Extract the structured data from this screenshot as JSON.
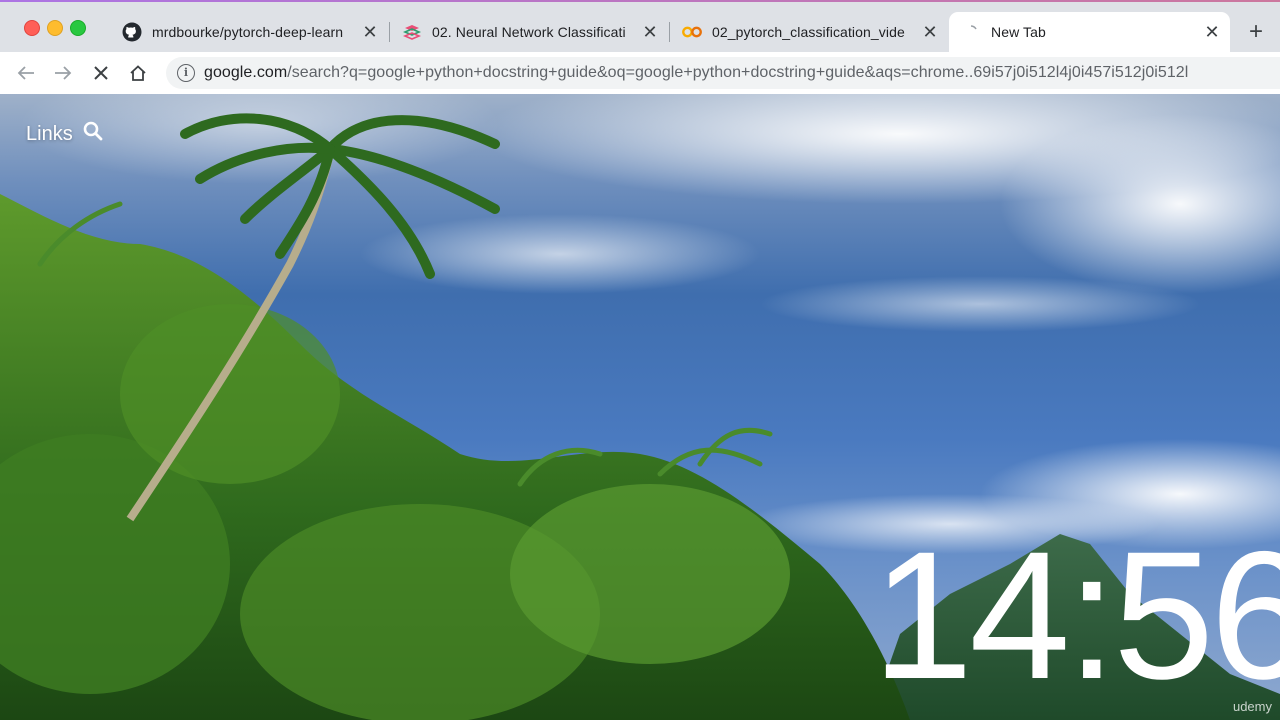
{
  "tabs": [
    {
      "title": "mrdbourke/pytorch-deep-learn",
      "icon": "github-icon",
      "active": false
    },
    {
      "title": "02. Neural Network Classificati",
      "icon": "book-icon",
      "active": false
    },
    {
      "title": "02_pytorch_classification_vide",
      "icon": "colab-icon",
      "active": false
    },
    {
      "title": "New Tab",
      "icon": "loading-icon",
      "active": true
    }
  ],
  "toolbar": {
    "url_domain": "google.com",
    "url_path": "/search?q=google+python+docstring+guide&oq=google+python+docstring+guide&aqs=chrome..69i57j0i512l4j0i457i512j0i512l"
  },
  "newtab_page": {
    "links_label": "Links",
    "clock": "14:56"
  },
  "watermark": "udemy",
  "colors": {
    "tabstrip_bg": "#dee1e6",
    "close_red": "#ff5f57",
    "minimize_yellow": "#febc2e",
    "zoom_green": "#28c840",
    "sky_blue": "#3f6eae"
  }
}
